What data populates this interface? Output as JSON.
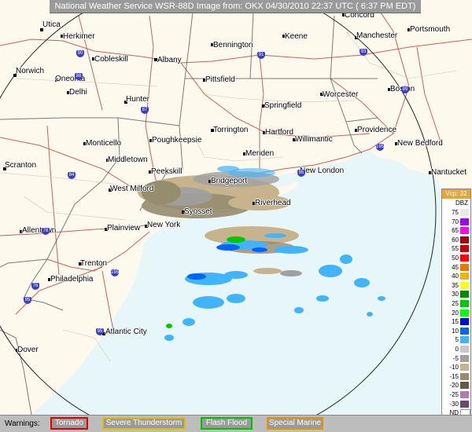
{
  "header": {
    "title": "National Weather Service WSR-88D Image from: OKX 04/30/2010 22:37 UTC ( 6:37 PM EDT)"
  },
  "legend": {
    "title": "Vcp: 32",
    "unit": "DBZ",
    "items": [
      {
        "label": "75",
        "color": "#e8e8e8"
      },
      {
        "label": "70",
        "color": "#a000f0"
      },
      {
        "label": "65",
        "color": "#ff00ff"
      },
      {
        "label": "60",
        "color": "#a00000"
      },
      {
        "label": "55",
        "color": "#c80000"
      },
      {
        "label": "50",
        "color": "#ff0000"
      },
      {
        "label": "45",
        "color": "#e87800"
      },
      {
        "label": "40",
        "color": "#f0b400"
      },
      {
        "label": "35",
        "color": "#ffff00"
      },
      {
        "label": "30",
        "color": "#008c00"
      },
      {
        "label": "25",
        "color": "#00c800"
      },
      {
        "label": "20",
        "color": "#00ff00"
      },
      {
        "label": "15",
        "color": "#0000f0"
      },
      {
        "label": "10",
        "color": "#0064ff"
      },
      {
        "label": "5",
        "color": "#40b4ff"
      },
      {
        "label": "0",
        "color": "#c8c8c8"
      },
      {
        "label": "-5",
        "color": "#a0a0a0"
      },
      {
        "label": "-10",
        "color": "#c8b48c"
      },
      {
        "label": "-15",
        "color": "#968c6e"
      },
      {
        "label": "-20",
        "color": "#645a46"
      },
      {
        "label": "-25",
        "color": "#b478b4"
      },
      {
        "label": "-30",
        "color": "#6e466e"
      },
      {
        "label": "ND",
        "color": "#ffffff"
      }
    ]
  },
  "warnings": {
    "label": "Warnings:",
    "items": [
      {
        "label": "Tornado",
        "color": "#e00000"
      },
      {
        "label": "Severe Thunderstorm",
        "color": "#e0c000"
      },
      {
        "label": "Flash Flood",
        "color": "#00c000"
      },
      {
        "label": "Special Marine",
        "color": "#e89000"
      }
    ]
  },
  "cities": [
    {
      "name": "Utica"
    },
    {
      "name": "Herkimer"
    },
    {
      "name": "Cobleskill"
    },
    {
      "name": "Albany"
    },
    {
      "name": "Bennington"
    },
    {
      "name": "Keene"
    },
    {
      "name": "Concord"
    },
    {
      "name": "Manchester"
    },
    {
      "name": "Portsmouth"
    },
    {
      "name": "Norwich"
    },
    {
      "name": "Oneonta"
    },
    {
      "name": "Delhi"
    },
    {
      "name": "Pittsfield"
    },
    {
      "name": "Worcester"
    },
    {
      "name": "Boston"
    },
    {
      "name": "Hunter"
    },
    {
      "name": "Springfield"
    },
    {
      "name": "Torrington"
    },
    {
      "name": "Hartford"
    },
    {
      "name": "Willimantic"
    },
    {
      "name": "Providence"
    },
    {
      "name": "New Bedford"
    },
    {
      "name": "Monticello"
    },
    {
      "name": "Poughkeepsie"
    },
    {
      "name": "Middletown"
    },
    {
      "name": "Meriden"
    },
    {
      "name": "Scranton"
    },
    {
      "name": "Peekskill"
    },
    {
      "name": "Bridgeport"
    },
    {
      "name": "New London"
    },
    {
      "name": "Nantucket"
    },
    {
      "name": "West Milford"
    },
    {
      "name": "Riverhead"
    },
    {
      "name": "Syosset"
    },
    {
      "name": "Allentown"
    },
    {
      "name": "Plainview"
    },
    {
      "name": "New York"
    },
    {
      "name": "Trenton"
    },
    {
      "name": "Philadelphia"
    },
    {
      "name": "Atlantic City"
    },
    {
      "name": "Dover"
    }
  ],
  "shields": [
    {
      "label": "90"
    },
    {
      "label": "88"
    },
    {
      "label": "91"
    },
    {
      "label": "93"
    },
    {
      "label": "87"
    },
    {
      "label": "84"
    },
    {
      "label": "195"
    },
    {
      "label": "95"
    },
    {
      "label": "78"
    },
    {
      "label": "195"
    },
    {
      "label": "76"
    },
    {
      "label": "95"
    },
    {
      "label": "95"
    },
    {
      "label": "89"
    }
  ]
}
